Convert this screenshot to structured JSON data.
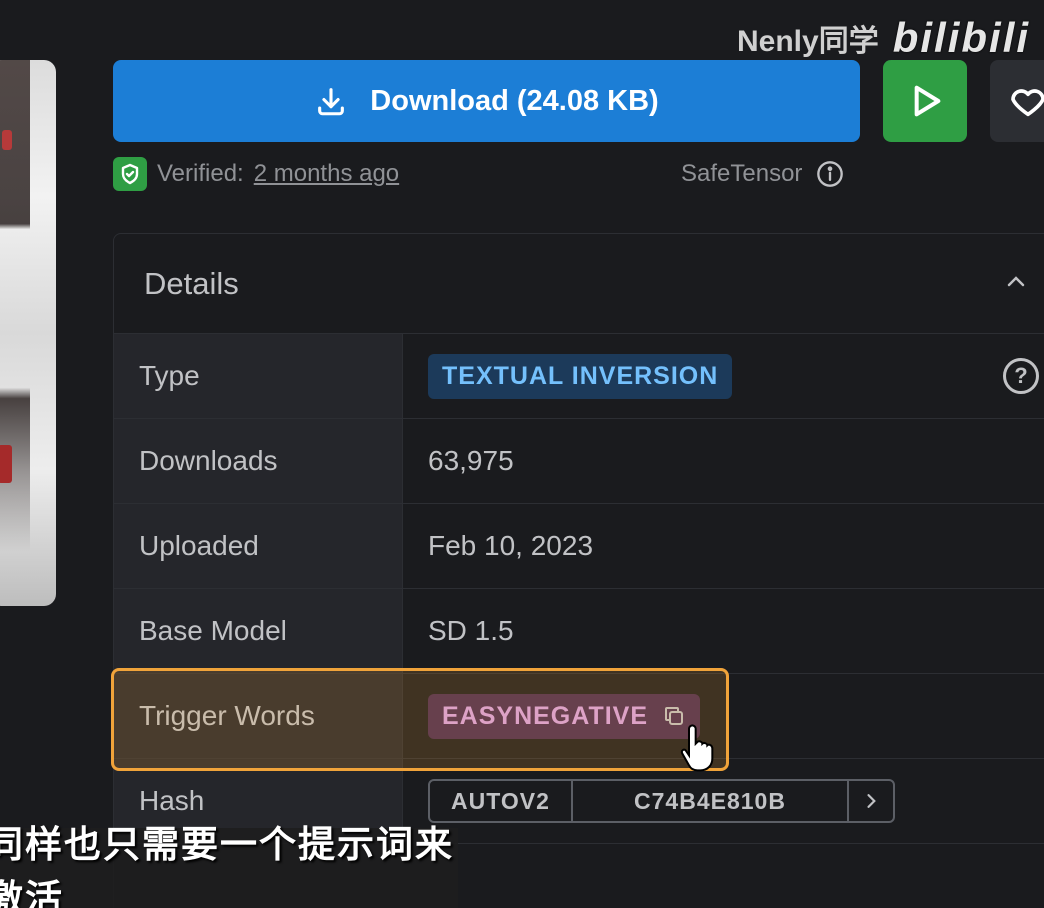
{
  "watermark": {
    "author": "Nenly同学",
    "site": "bilibili"
  },
  "actions": {
    "download_label": "Download (24.08 KB)",
    "verified_prefix": "Verified:",
    "verified_time": "2 months ago",
    "format_label": "SafeTensor"
  },
  "details": {
    "title": "Details",
    "rows": [
      {
        "key": "Type",
        "value": "TEXTUAL INVERSION"
      },
      {
        "key": "Downloads",
        "value": "63,975"
      },
      {
        "key": "Uploaded",
        "value": "Feb 10, 2023"
      },
      {
        "key": "Base Model",
        "value": "SD 1.5"
      },
      {
        "key": "Trigger Words",
        "value": "EASYNEGATIVE"
      },
      {
        "key": "Hash",
        "value_type": "AUTOV2",
        "value": "C74B4E810B"
      }
    ]
  },
  "subtitle": "同样也只需要一个提示词来激活",
  "colors": {
    "primary": "#1c7ed6",
    "success": "#2f9e44",
    "highlight": "#f0a33a"
  }
}
